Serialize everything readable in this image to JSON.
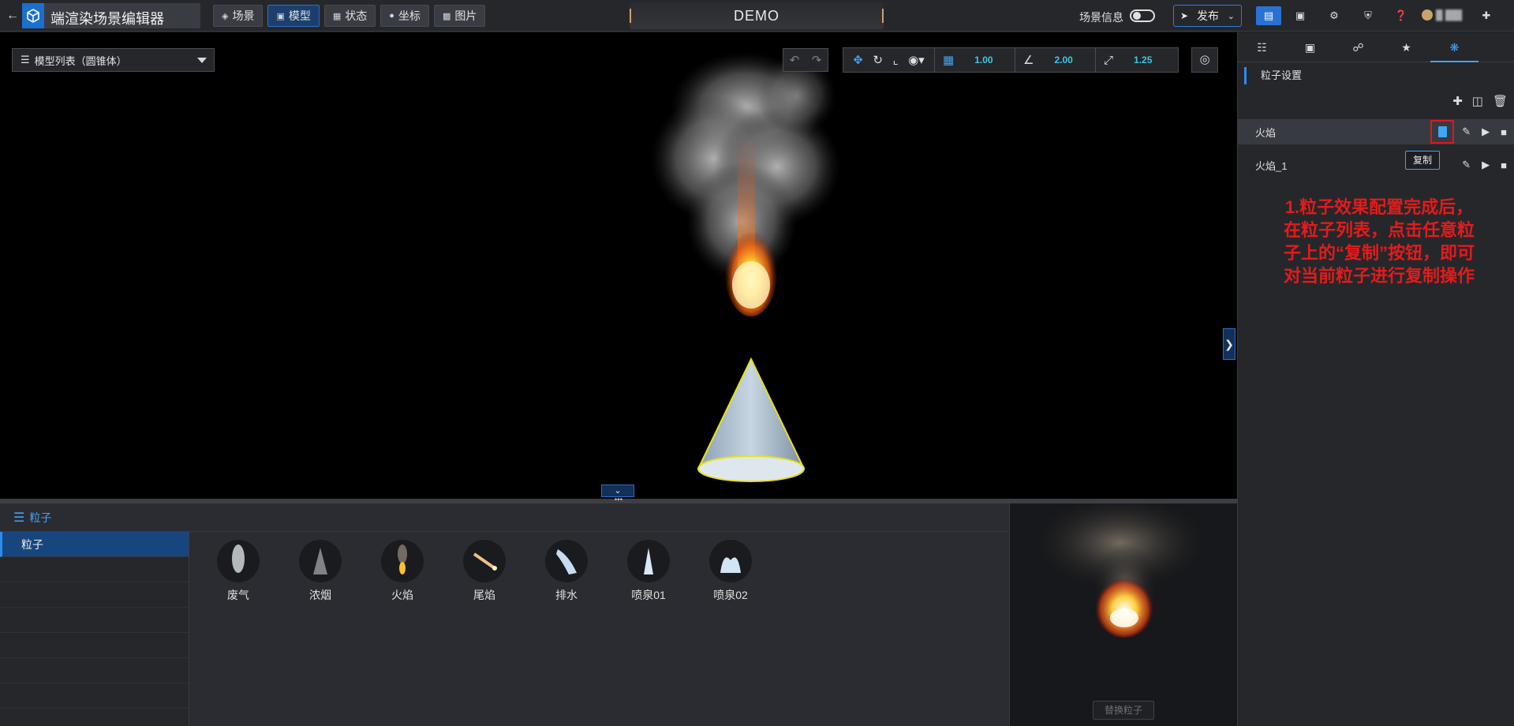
{
  "app": {
    "title": "端渲染场景编辑器",
    "back_icon": "arrow-left-icon",
    "logo_icon": "cube-logo-icon"
  },
  "nav": [
    {
      "label": "场景",
      "icon": "layers-icon",
      "active": false
    },
    {
      "label": "模型",
      "icon": "cube-icon",
      "active": true
    },
    {
      "label": "状态",
      "icon": "grid-icon",
      "active": false
    },
    {
      "label": "坐标",
      "icon": "pin-icon",
      "active": false
    },
    {
      "label": "图片",
      "icon": "image-icon",
      "active": false
    }
  ],
  "header": {
    "demo_title": "DEMO",
    "scene_info_label": "场景信息",
    "publish_label": "发布"
  },
  "viewport": {
    "model_select_value": "模型列表（圆锥体）",
    "transform": {
      "grid_value": "1.00",
      "angle_value": "2.00",
      "scale_value": "1.25"
    }
  },
  "bottom": {
    "panel_title": "粒子",
    "category_active": "粒子",
    "particles": [
      {
        "label": "废气",
        "icon": "exhaust-thumb-icon"
      },
      {
        "label": "浓烟",
        "icon": "smoke-thumb-icon"
      },
      {
        "label": "火焰",
        "icon": "fire-thumb-icon"
      },
      {
        "label": "尾焰",
        "icon": "tail-flame-thumb-icon"
      },
      {
        "label": "排水",
        "icon": "drain-thumb-icon"
      },
      {
        "label": "喷泉01",
        "icon": "fountain01-thumb-icon"
      },
      {
        "label": "喷泉02",
        "icon": "fountain02-thumb-icon"
      }
    ],
    "replace_label": "替换粒子"
  },
  "right_panel": {
    "section_title": "粒子设置",
    "particle_rows": [
      {
        "name": "火焰",
        "selected": true
      },
      {
        "name": "火焰_1",
        "selected": false
      }
    ],
    "tooltip": "复制",
    "annotation_lines": [
      "1.粒子效果配置完成后，",
      "在粒子列表，点击任意粒",
      "子上的“复制”按钮，即可",
      "对当前粒子进行复制操作"
    ]
  },
  "colors": {
    "accent": "#3fa6f5",
    "annotation_red": "#e31b1b",
    "highlight_box": "#e01818"
  }
}
